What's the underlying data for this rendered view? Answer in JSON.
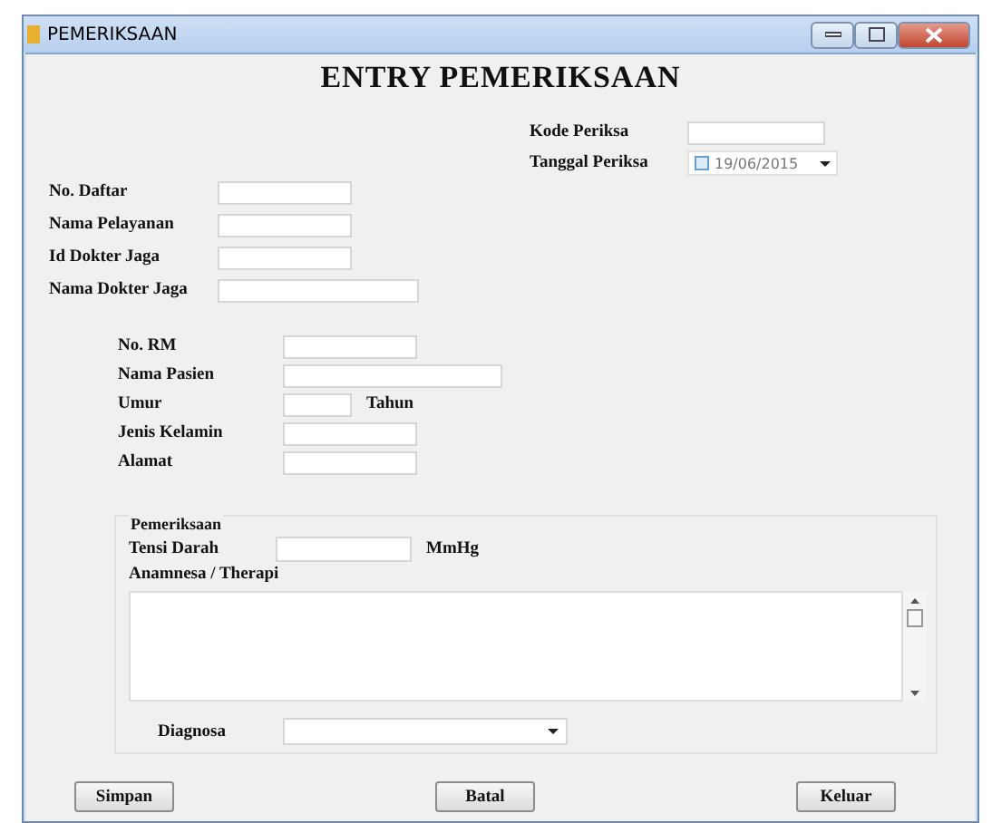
{
  "window": {
    "title": "PEMERIKSAAN"
  },
  "heading": "ENTRY PEMERIKSAAN",
  "header_fields": [
    {
      "label": "Kode Periksa",
      "kind": "text"
    },
    {
      "label": "Tanggal Periksa",
      "kind": "date",
      "value": "19/06/2015",
      "checked": false
    }
  ],
  "service_fields": [
    {
      "label": "No. Daftar"
    },
    {
      "label": "Nama Pelayanan"
    },
    {
      "label": "Id Dokter Jaga"
    },
    {
      "label": "Nama Dokter Jaga"
    }
  ],
  "patient_fields": [
    {
      "label": "No. RM"
    },
    {
      "label": "Nama Pasien"
    },
    {
      "label": "Umur",
      "unit": "Tahun"
    },
    {
      "label": "Jenis Kelamin"
    },
    {
      "label": "Alamat"
    }
  ],
  "examination": {
    "title": "Pemeriksaan",
    "blood_pressure": {
      "label": "Tensi Darah",
      "unit": "MmHg"
    },
    "notes_label": "Anamnesa / Therapi",
    "diagnosis": {
      "label": "Diagnosa"
    }
  },
  "buttons": [
    "Simpan",
    "Batal",
    "Keluar"
  ]
}
